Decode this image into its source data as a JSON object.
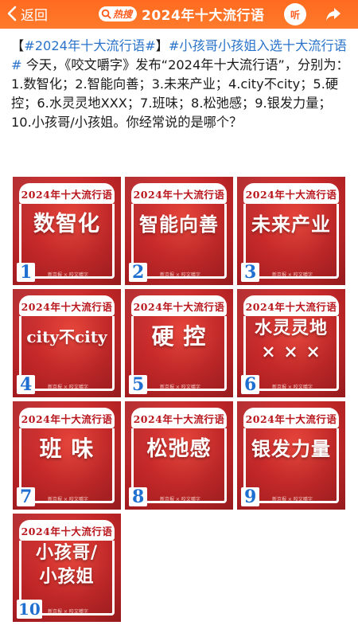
{
  "header": {
    "back_label": "返回",
    "hot_badge": "热搜",
    "title": "2024年十大流行语",
    "listen_label": "听"
  },
  "post": {
    "tag1": "#2024年十大流行语#",
    "tag2": "#小孩哥小孩姐入选十大流行语#",
    "text": " 今天，《咬文嚼字》发布“2024年十大流行语”，分别为：1.数智化；2.智能向善；3.未来产业；4.city不city；5.硬控；6.水灵灵地XXX；7.班味；8.松弛感；9.银发力量；10.小孩哥/小孩姐。你经常说的是哪个？"
  },
  "cards": [
    {
      "header": "2024年十大流行语",
      "word": "数智化",
      "num": "1",
      "credit": "新京报 × 咬文嚼字"
    },
    {
      "header": "2024年十大流行语",
      "word": "智能向善",
      "num": "2",
      "credit": "新京报 × 咬文嚼字"
    },
    {
      "header": "2024年十大流行语",
      "word": "未来产业",
      "num": "3",
      "credit": "新京报 × 咬文嚼字"
    },
    {
      "header": "2024年十大流行语",
      "word": "city不city",
      "num": "4",
      "credit": "新京报 × 咬文嚼字"
    },
    {
      "header": "2024年十大流行语",
      "word": "硬 控",
      "num": "5",
      "credit": "新京报 × 咬文嚼字"
    },
    {
      "header": "2024年十大流行语",
      "word": "水灵灵地",
      "word2": "× × ×",
      "num": "6",
      "credit": "新京报 × 咬文嚼字"
    },
    {
      "header": "2024年十大流行语",
      "word": "班 味",
      "num": "7",
      "credit": "新京报 × 咬文嚼字"
    },
    {
      "header": "2024年十大流行语",
      "word": "松弛感",
      "num": "8",
      "credit": "新京报 × 咬文嚼字"
    },
    {
      "header": "2024年十大流行语",
      "word": "银发力量",
      "num": "9",
      "credit": "新京报 × 咬文嚼字"
    },
    {
      "header": "2024年十大流行语",
      "word": "小孩哥/",
      "word2": "小孩姐",
      "num": "10",
      "credit": "新京报 × 咬文嚼字"
    }
  ]
}
